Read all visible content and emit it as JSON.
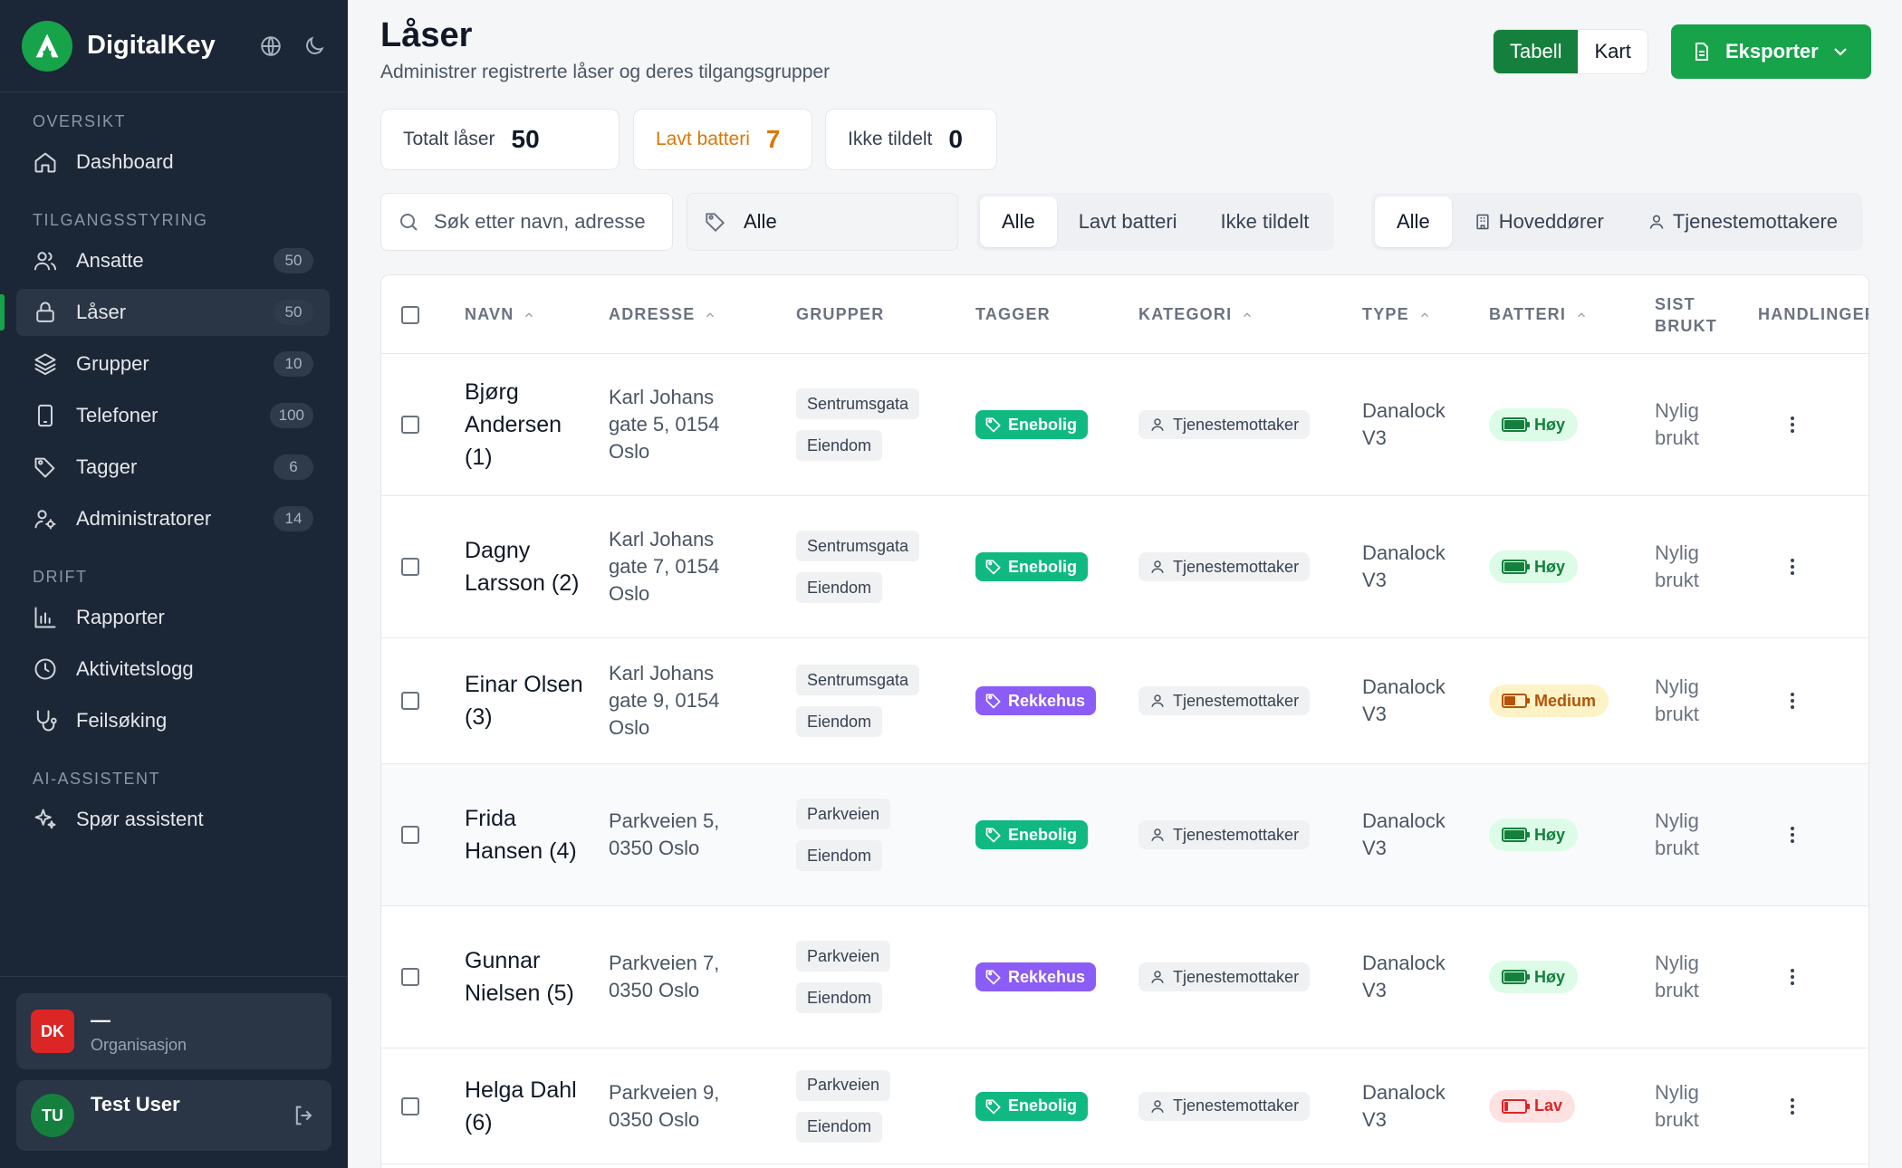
{
  "app": {
    "name": "DigitalKey"
  },
  "nav": {
    "sections": [
      {
        "title": "OVERSIKT",
        "items": [
          {
            "label": "Dashboard",
            "icon": "home-icon",
            "badge": ""
          }
        ]
      },
      {
        "title": "TILGANGSSTYRING",
        "items": [
          {
            "label": "Ansatte",
            "icon": "users-icon",
            "badge": "50"
          },
          {
            "label": "Låser",
            "icon": "lock-icon",
            "badge": "50",
            "active": true
          },
          {
            "label": "Grupper",
            "icon": "layers-icon",
            "badge": "10"
          },
          {
            "label": "Telefoner",
            "icon": "phone-icon",
            "badge": "100"
          },
          {
            "label": "Tagger",
            "icon": "tag-icon",
            "badge": "6"
          },
          {
            "label": "Administratorer",
            "icon": "user-cog-icon",
            "badge": "14"
          }
        ]
      },
      {
        "title": "DRIFT",
        "items": [
          {
            "label": "Rapporter",
            "icon": "bar-chart-icon",
            "badge": ""
          },
          {
            "label": "Aktivitetslogg",
            "icon": "clock-icon",
            "badge": ""
          },
          {
            "label": "Feilsøking",
            "icon": "stethoscope-icon",
            "badge": ""
          }
        ]
      },
      {
        "title": "AI-ASSISTENT",
        "items": [
          {
            "label": "Spør assistent",
            "icon": "sparkles-icon",
            "badge": ""
          }
        ]
      }
    ]
  },
  "org": {
    "initials": "DK",
    "name": "—",
    "sub": "Organisasjon"
  },
  "user": {
    "initials": "TU",
    "name": "Test User"
  },
  "page": {
    "title": "Låser",
    "subtitle": "Administrer registrerte låser og deres tilgangsgrupper"
  },
  "view": {
    "table": "Tabell",
    "map": "Kart",
    "active": "Tabell"
  },
  "export": {
    "label": "Eksporter"
  },
  "stats": [
    {
      "label": "Totalt låser",
      "value": "50"
    },
    {
      "label": "Lavt batteri",
      "value": "7"
    },
    {
      "label": "Ikke tildelt",
      "value": "0"
    }
  ],
  "search": {
    "placeholder": "Søk etter navn, adresse",
    "value": ""
  },
  "tag_filter": {
    "value": "Alle"
  },
  "status_filter": {
    "options": [
      "Alle",
      "Lavt batteri",
      "Ikke tildelt"
    ],
    "active": "Alle"
  },
  "category_filter": {
    "options": [
      "Alle",
      "Hoveddører",
      "Tjenestemottakere"
    ],
    "active": "Alle"
  },
  "table": {
    "columns": {
      "navn": "Navn",
      "adresse": "Adresse",
      "grupper": "GRUPPER",
      "tagger": "TAGGER",
      "kategori": "Kategori",
      "type": "Type",
      "batteri": "Batteri",
      "sist_l1": "SIST",
      "sist_l2": "BRUKT",
      "handlinger": "HANDLINGER"
    },
    "rows": [
      {
        "name": "Bjørg Andersen (1)",
        "address": "Karl Johans gate 5, 0154 Oslo",
        "groups": [
          "Sentrumsgata",
          "Eiendom"
        ],
        "tag": "Enebolig",
        "tag_color": "#10b981",
        "category": "Tjenestemottaker",
        "type": "Danalock V3",
        "battery": "Høy",
        "battery_level": "high",
        "last_used": "Nylig brukt"
      },
      {
        "name": "Dagny Larsson (2)",
        "address": "Karl Johans gate 7, 0154 Oslo",
        "groups": [
          "Sentrumsgata",
          "Eiendom"
        ],
        "tag": "Enebolig",
        "tag_color": "#10b981",
        "category": "Tjenestemottaker",
        "type": "Danalock V3",
        "battery": "Høy",
        "battery_level": "high",
        "last_used": "Nylig brukt"
      },
      {
        "name": "Einar Olsen (3)",
        "address": "Karl Johans gate 9, 0154 Oslo",
        "groups": [
          "Sentrumsgata",
          "Eiendom"
        ],
        "tag": "Rekkehus",
        "tag_color": "#8b5cf6",
        "category": "Tjenestemottaker",
        "type": "Danalock V3",
        "battery": "Medium",
        "battery_level": "medium",
        "last_used": "Nylig brukt"
      },
      {
        "name": "Frida Hansen (4)",
        "address": "Parkveien 5, 0350 Oslo",
        "groups": [
          "Parkveien",
          "Eiendom"
        ],
        "tag": "Enebolig",
        "tag_color": "#10b981",
        "category": "Tjenestemottaker",
        "type": "Danalock V3",
        "battery": "Høy",
        "battery_level": "high",
        "last_used": "Nylig brukt"
      },
      {
        "name": "Gunnar Nielsen (5)",
        "address": "Parkveien 7, 0350 Oslo",
        "groups": [
          "Parkveien",
          "Eiendom"
        ],
        "tag": "Rekkehus",
        "tag_color": "#8b5cf6",
        "category": "Tjenestemottaker",
        "type": "Danalock V3",
        "battery": "Høy",
        "battery_level": "high",
        "last_used": "Nylig brukt"
      },
      {
        "name": "Helga Dahl (6)",
        "address": "Parkveien 9, 0350 Oslo",
        "groups": [
          "Parkveien",
          "Eiendom"
        ],
        "tag": "Enebolig",
        "tag_color": "#10b981",
        "category": "Tjenestemottaker",
        "type": "Danalock V3",
        "battery": "Lav",
        "battery_level": "low",
        "last_used": "Nylig brukt"
      }
    ]
  }
}
